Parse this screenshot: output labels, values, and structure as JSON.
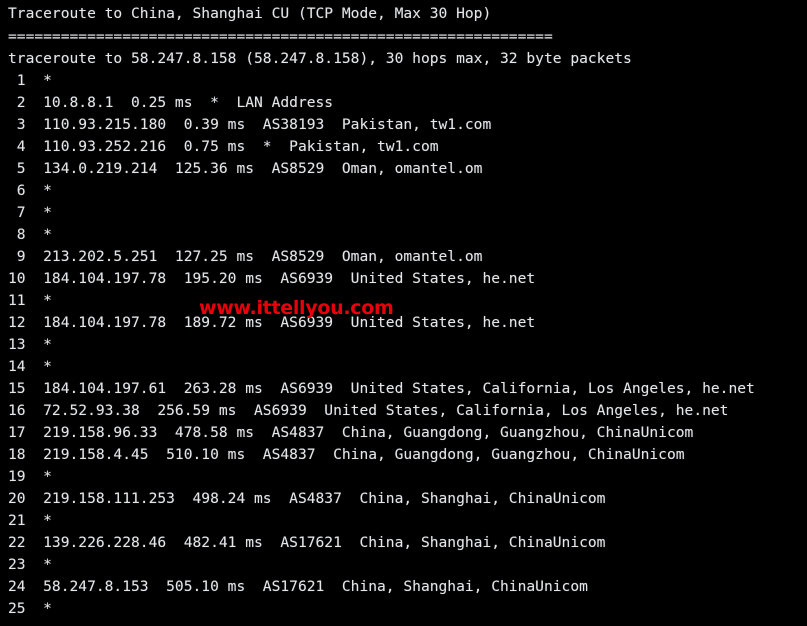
{
  "terminal": {
    "background_color": "#000000",
    "text_color": "#e6e6e6",
    "title_line": "Traceroute to China, Shanghai CU (TCP Mode, Max 30 Hop)",
    "separator_line": "==============================================================",
    "summary_line": "traceroute to 58.247.8.158 (58.247.8.158), 30 hops max, 32 byte packets",
    "target_ip": "58.247.8.158",
    "max_hops": "30",
    "packet_size": "32 byte packets",
    "mode": "TCP Mode"
  },
  "watermark": {
    "text": "www.ittellyou.com",
    "color": "#e8000d"
  },
  "hops": [
    {
      "line": " 1  *"
    },
    {
      "line": " 2  10.8.8.1  0.25 ms  *  LAN Address"
    },
    {
      "line": " 3  110.93.215.180  0.39 ms  AS38193  Pakistan, tw1.com"
    },
    {
      "line": " 4  110.93.252.216  0.75 ms  *  Pakistan, tw1.com"
    },
    {
      "line": " 5  134.0.219.214  125.36 ms  AS8529  Oman, omantel.om"
    },
    {
      "line": " 6  *"
    },
    {
      "line": " 7  *"
    },
    {
      "line": " 8  *"
    },
    {
      "line": " 9  213.202.5.251  127.25 ms  AS8529  Oman, omantel.om"
    },
    {
      "line": "10  184.104.197.78  195.20 ms  AS6939  United States, he.net"
    },
    {
      "line": "11  *"
    },
    {
      "line": "12  184.104.197.78  189.72 ms  AS6939  United States, he.net"
    },
    {
      "line": "13  *"
    },
    {
      "line": "14  *"
    },
    {
      "line": "15  184.104.197.61  263.28 ms  AS6939  United States, California, Los Angeles, he.net"
    },
    {
      "line": "16  72.52.93.38  256.59 ms  AS6939  United States, California, Los Angeles, he.net"
    },
    {
      "line": "17  219.158.96.33  478.58 ms  AS4837  China, Guangdong, Guangzhou, ChinaUnicom"
    },
    {
      "line": "18  219.158.4.45  510.10 ms  AS4837  China, Guangdong, Guangzhou, ChinaUnicom"
    },
    {
      "line": "19  *"
    },
    {
      "line": "20  219.158.111.253  498.24 ms  AS4837  China, Shanghai, ChinaUnicom"
    },
    {
      "line": "21  *"
    },
    {
      "line": "22  139.226.228.46  482.41 ms  AS17621  China, Shanghai, ChinaUnicom"
    },
    {
      "line": "23  *"
    },
    {
      "line": "24  58.247.8.153  505.10 ms  AS17621  China, Shanghai, ChinaUnicom"
    },
    {
      "line": "25  *"
    }
  ],
  "hop_details": [
    {
      "hop": "1",
      "ip": "",
      "latency": "",
      "asn": "",
      "location": ""
    },
    {
      "hop": "2",
      "ip": "10.8.8.1",
      "latency": "0.25 ms",
      "asn": "*",
      "location": "LAN Address"
    },
    {
      "hop": "3",
      "ip": "110.93.215.180",
      "latency": "0.39 ms",
      "asn": "AS38193",
      "location": "Pakistan, tw1.com"
    },
    {
      "hop": "4",
      "ip": "110.93.252.216",
      "latency": "0.75 ms",
      "asn": "*",
      "location": "Pakistan, tw1.com"
    },
    {
      "hop": "5",
      "ip": "134.0.219.214",
      "latency": "125.36 ms",
      "asn": "AS8529",
      "location": "Oman, omantel.om"
    },
    {
      "hop": "6",
      "ip": "",
      "latency": "",
      "asn": "",
      "location": ""
    },
    {
      "hop": "7",
      "ip": "",
      "latency": "",
      "asn": "",
      "location": ""
    },
    {
      "hop": "8",
      "ip": "",
      "latency": "",
      "asn": "",
      "location": ""
    },
    {
      "hop": "9",
      "ip": "213.202.5.251",
      "latency": "127.25 ms",
      "asn": "AS8529",
      "location": "Oman, omantel.om"
    },
    {
      "hop": "10",
      "ip": "184.104.197.78",
      "latency": "195.20 ms",
      "asn": "AS6939",
      "location": "United States, he.net"
    },
    {
      "hop": "11",
      "ip": "",
      "latency": "",
      "asn": "",
      "location": ""
    },
    {
      "hop": "12",
      "ip": "184.104.197.78",
      "latency": "189.72 ms",
      "asn": "AS6939",
      "location": "United States, he.net"
    },
    {
      "hop": "13",
      "ip": "",
      "latency": "",
      "asn": "",
      "location": ""
    },
    {
      "hop": "14",
      "ip": "",
      "latency": "",
      "asn": "",
      "location": ""
    },
    {
      "hop": "15",
      "ip": "184.104.197.61",
      "latency": "263.28 ms",
      "asn": "AS6939",
      "location": "United States, California, Los Angeles, he.net"
    },
    {
      "hop": "16",
      "ip": "72.52.93.38",
      "latency": "256.59 ms",
      "asn": "AS6939",
      "location": "United States, California, Los Angeles, he.net"
    },
    {
      "hop": "17",
      "ip": "219.158.96.33",
      "latency": "478.58 ms",
      "asn": "AS4837",
      "location": "China, Guangdong, Guangzhou, ChinaUnicom"
    },
    {
      "hop": "18",
      "ip": "219.158.4.45",
      "latency": "510.10 ms",
      "asn": "AS4837",
      "location": "China, Guangdong, Guangzhou, ChinaUnicom"
    },
    {
      "hop": "19",
      "ip": "",
      "latency": "",
      "asn": "",
      "location": ""
    },
    {
      "hop": "20",
      "ip": "219.158.111.253",
      "latency": "498.24 ms",
      "asn": "AS4837",
      "location": "China, Shanghai, ChinaUnicom"
    },
    {
      "hop": "21",
      "ip": "",
      "latency": "",
      "asn": "",
      "location": ""
    },
    {
      "hop": "22",
      "ip": "139.226.228.46",
      "latency": "482.41 ms",
      "asn": "AS17621",
      "location": "China, Shanghai, ChinaUnicom"
    },
    {
      "hop": "23",
      "ip": "",
      "latency": "",
      "asn": "",
      "location": ""
    },
    {
      "hop": "24",
      "ip": "58.247.8.153",
      "latency": "505.10 ms",
      "asn": "AS17621",
      "location": "China, Shanghai, ChinaUnicom"
    },
    {
      "hop": "25",
      "ip": "",
      "latency": "",
      "asn": "",
      "location": ""
    }
  ]
}
